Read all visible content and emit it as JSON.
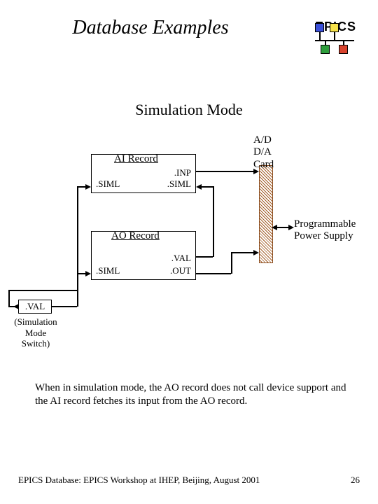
{
  "title": "Database Examples",
  "logo_text": "EPICS",
  "subtitle": "Simulation Mode",
  "diagram": {
    "ai_record": {
      "title": "AI Record",
      "inp": ".INP",
      "siml_left": ".SIML",
      "siml_right": ".SIML"
    },
    "ao_record": {
      "title": "AO Record",
      "val": ".VAL",
      "siml": ".SIML",
      "out": ".OUT"
    },
    "ad_card": "A/D\nD/A\nCard",
    "supply": "Programmable\nPower Supply",
    "val_box": ".VAL",
    "sim_caption": "(Simulation\nMode\nSwitch)"
  },
  "body_text": "When in simulation mode, the AO record does not call device support and the AI record fetches its input from the AO record.",
  "footer_left": "EPICS Database: EPICS Workshop at IHEP, Beijing, August 2001",
  "footer_right": "26",
  "chart_data": {
    "type": "diagram",
    "title": "Simulation Mode",
    "nodes": [
      {
        "id": "ai",
        "label": "AI Record",
        "ports": [
          ".INP",
          ".SIML",
          ".SIML"
        ]
      },
      {
        "id": "ao",
        "label": "AO Record",
        "ports": [
          ".VAL",
          ".SIML",
          ".OUT"
        ]
      },
      {
        "id": "adda",
        "label": "A/D D/A Card"
      },
      {
        "id": "supply",
        "label": "Programmable Power Supply"
      },
      {
        "id": "sim_switch",
        "label": ".VAL (Simulation Mode Switch)"
      }
    ],
    "edges": [
      {
        "from": "ai.INP",
        "to": "adda"
      },
      {
        "from": "adda",
        "to": "supply",
        "bidirectional": true
      },
      {
        "from": "ao.OUT",
        "to": "adda"
      },
      {
        "from": "ao.VAL",
        "to": "ai.SIML_right"
      },
      {
        "from": "sim_switch",
        "to": "ai.SIML_left"
      },
      {
        "from": "sim_switch",
        "to": "ao.SIML"
      }
    ]
  }
}
